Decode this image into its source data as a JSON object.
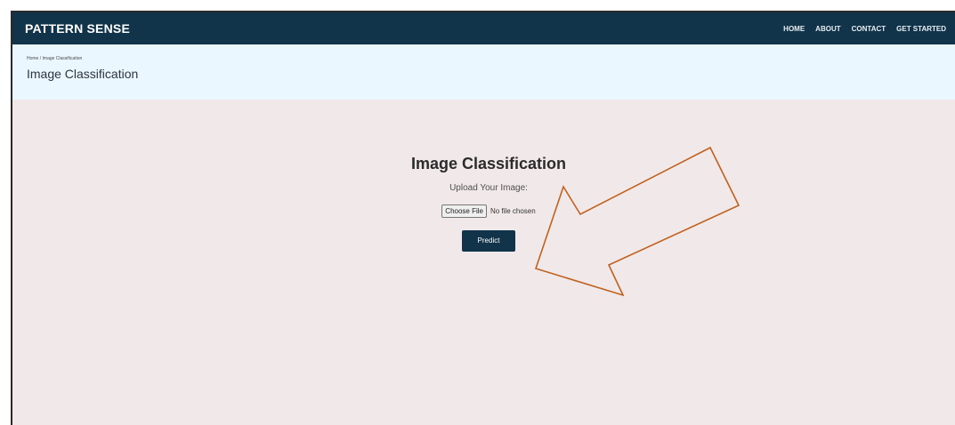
{
  "brand": "PATTERN SENSE",
  "nav": {
    "items": [
      {
        "label": "HOME"
      },
      {
        "label": "ABOUT"
      },
      {
        "label": "CONTACT"
      },
      {
        "label": "GET STARTED"
      }
    ]
  },
  "breadcrumb": {
    "home": "Home",
    "separator": " / ",
    "current": "Image Classification"
  },
  "subheader": {
    "title": "Image Classification"
  },
  "main": {
    "title": "Image Classification",
    "upload_label": "Upload Your Image:",
    "file_button": "Choose File",
    "file_status": "No file chosen",
    "predict_label": "Predict"
  },
  "colors": {
    "nav_bg": "#12344a",
    "breadcrumb_bg": "#eaf7ff",
    "page_bg": "#f1e9e9",
    "arrow": "#c0611f"
  },
  "annotation": {
    "type": "arrow",
    "pointing_to": "predict-button"
  }
}
